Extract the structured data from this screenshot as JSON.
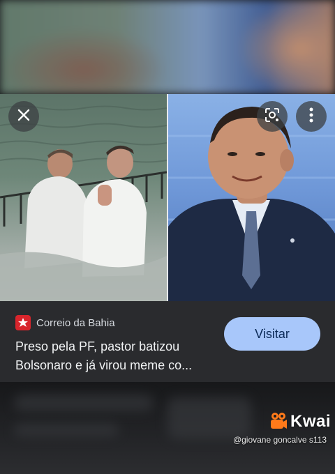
{
  "viewer": {
    "close_icon": "close-icon",
    "lens_icon": "google-lens-icon",
    "more_icon": "more-vert-icon"
  },
  "result": {
    "source_name": "Correio da Bahia",
    "source_logo_color": "#d8252c",
    "headline": "Preso pela PF, pastor batizou Bolsonaro e já virou meme co...",
    "visit_label": "Visitar",
    "visit_color": "#a8c7fa"
  },
  "watermark": {
    "app_name": "Kwai",
    "handle": "@giovane goncalve s113",
    "logo_color": "#ff7a1a"
  }
}
